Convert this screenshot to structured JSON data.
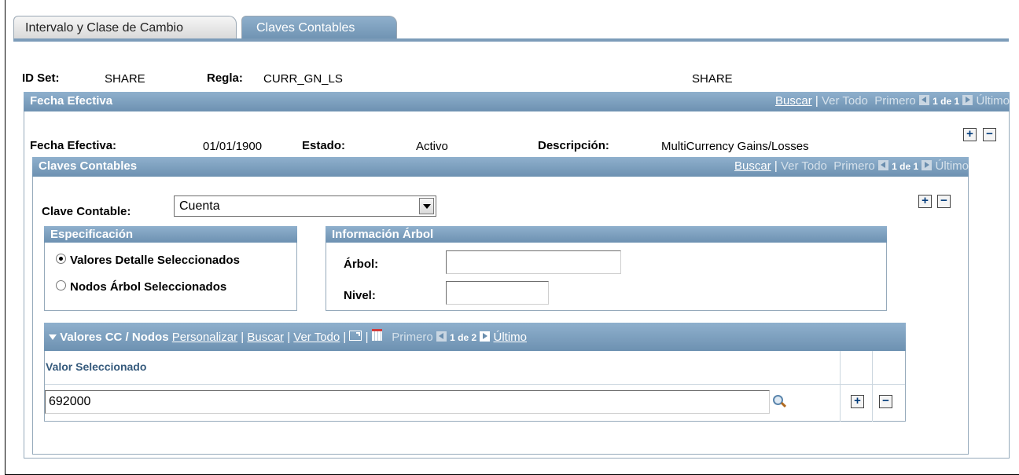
{
  "tabs": [
    {
      "label": "Intervalo y Clase de Cambio",
      "active": false
    },
    {
      "label": "Claves Contables",
      "active": true
    }
  ],
  "header": {
    "setid_label": "ID Set:",
    "setid_value": "SHARE",
    "rule_label": "Regla:",
    "rule_value": "CURR_GN_LS",
    "extra_value": "SHARE"
  },
  "effdate_grid": {
    "title": "Fecha Efectiva",
    "nav": {
      "find": "Buscar",
      "sep": "|",
      "view_all": "Ver Todo",
      "first": "Primero",
      "count": "1 de 1",
      "last": "Último"
    },
    "effdate_label": "Fecha Efectiva:",
    "effdate_value": "01/01/1900",
    "status_label": "Estado:",
    "status_value": "Activo",
    "descr_label": "Descripción:",
    "descr_value": "MultiCurrency Gains/Losses"
  },
  "chartfield_grid": {
    "title": "Claves Contables",
    "nav": {
      "find": "Buscar",
      "sep": "|",
      "view_all": "Ver Todo",
      "first": "Primero",
      "count": "1 de 1",
      "last": "Último"
    },
    "chartfield_label": "Clave Contable:",
    "chartfield_value": "Cuenta"
  },
  "specification": {
    "title": "Especificación",
    "options": [
      {
        "label": "Valores Detalle Seleccionados",
        "selected": true
      },
      {
        "label": "Nodos Árbol Seleccionados",
        "selected": false
      }
    ]
  },
  "tree_info": {
    "title": "Información Árbol",
    "tree_label": "Árbol:",
    "tree_value": "",
    "level_label": "Nivel:",
    "level_value": ""
  },
  "values_grid": {
    "title": "Valores CC / Nodos",
    "nav": {
      "customize": "Personalizar",
      "find": "Buscar",
      "view_all": "Ver Todo",
      "sep": "|",
      "first": "Primero",
      "count": "1 de 2",
      "last": "Último"
    },
    "column_header": "Valor Seleccionado",
    "rows": [
      {
        "value": "692000"
      }
    ]
  },
  "icons": {
    "add": "plus-icon",
    "delete": "minus-icon",
    "lookup": "magnifier-icon",
    "zoom": "new-window-icon",
    "download": "spreadsheet-icon",
    "collapse": "triangle-down-icon"
  },
  "colors": {
    "header_bg": "#7b9cba",
    "header_text": "#ffffff",
    "border": "#96aabb"
  }
}
